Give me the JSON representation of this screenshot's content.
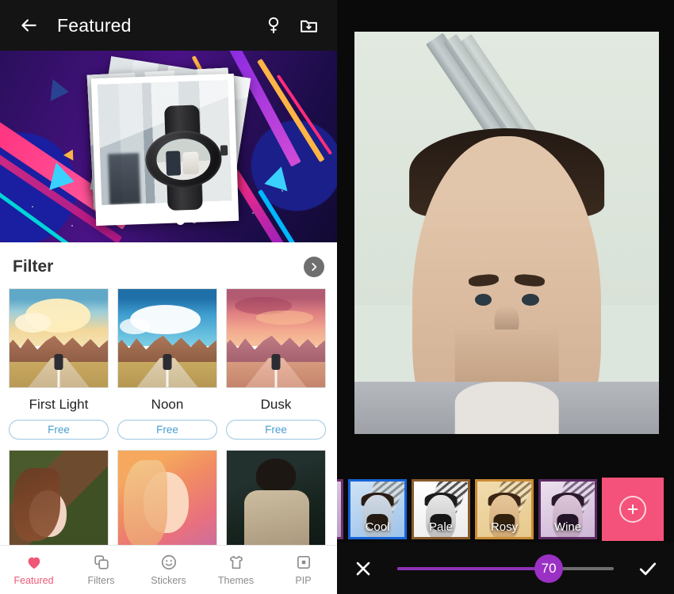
{
  "left": {
    "header": {
      "back_icon": "arrow-left-icon",
      "title": "Featured",
      "search_icon": "magnifier-icon",
      "download_icon": "folder-download-icon"
    },
    "hero": {
      "pager_count": 5,
      "pager_active_index": 3
    },
    "filter_section": {
      "title": "Filter",
      "more_icon": "chevron-right-icon",
      "cards": [
        {
          "name": "First Light",
          "price_label": "Free"
        },
        {
          "name": "Noon",
          "price_label": "Free"
        },
        {
          "name": "Dusk",
          "price_label": "Free"
        }
      ],
      "row2_thumbs": [
        "portrait-grass",
        "portrait-warm",
        "portrait-dark"
      ]
    },
    "tabbar": {
      "active": "Featured",
      "accent_color": "#ef5777",
      "items": [
        {
          "label": "Featured",
          "icon": "heart-icon",
          "active": true
        },
        {
          "label": "Filters",
          "icon": "layers-icon",
          "active": false
        },
        {
          "label": "Stickers",
          "icon": "smiley-icon",
          "active": false
        },
        {
          "label": "Themes",
          "icon": "tshirt-icon",
          "active": false
        },
        {
          "label": "PIP",
          "icon": "pip-frame-icon",
          "active": false
        }
      ]
    }
  },
  "right": {
    "canvas": {
      "preview_name": "edited-photo-preview"
    },
    "filter_strip": {
      "selected": "Cool",
      "selected_border_color": "#1664d8",
      "items": [
        {
          "label": "",
          "partial": true,
          "border": "#6d2f6d",
          "tint": "none"
        },
        {
          "label": "Cool",
          "partial": false,
          "border": "#1664d8",
          "tint": "cool"
        },
        {
          "label": "Pale",
          "partial": false,
          "border": "#8a5a2b",
          "tint": "pale"
        },
        {
          "label": "Rosy",
          "partial": false,
          "border": "#c98a33",
          "tint": "rosy"
        },
        {
          "label": "Wine",
          "partial": false,
          "border": "#5c2a63",
          "tint": "wine"
        }
      ],
      "add_button": {
        "icon": "plus-circle-icon",
        "color": "#f4527a"
      }
    },
    "action_bar": {
      "cancel_icon": "close-x-icon",
      "confirm_icon": "check-icon",
      "slider": {
        "value": 70,
        "min": 0,
        "max": 100,
        "fill_color": "#8e34b6",
        "knob_color": "#9b30c4",
        "track_color": "#6e6e6e"
      }
    }
  }
}
